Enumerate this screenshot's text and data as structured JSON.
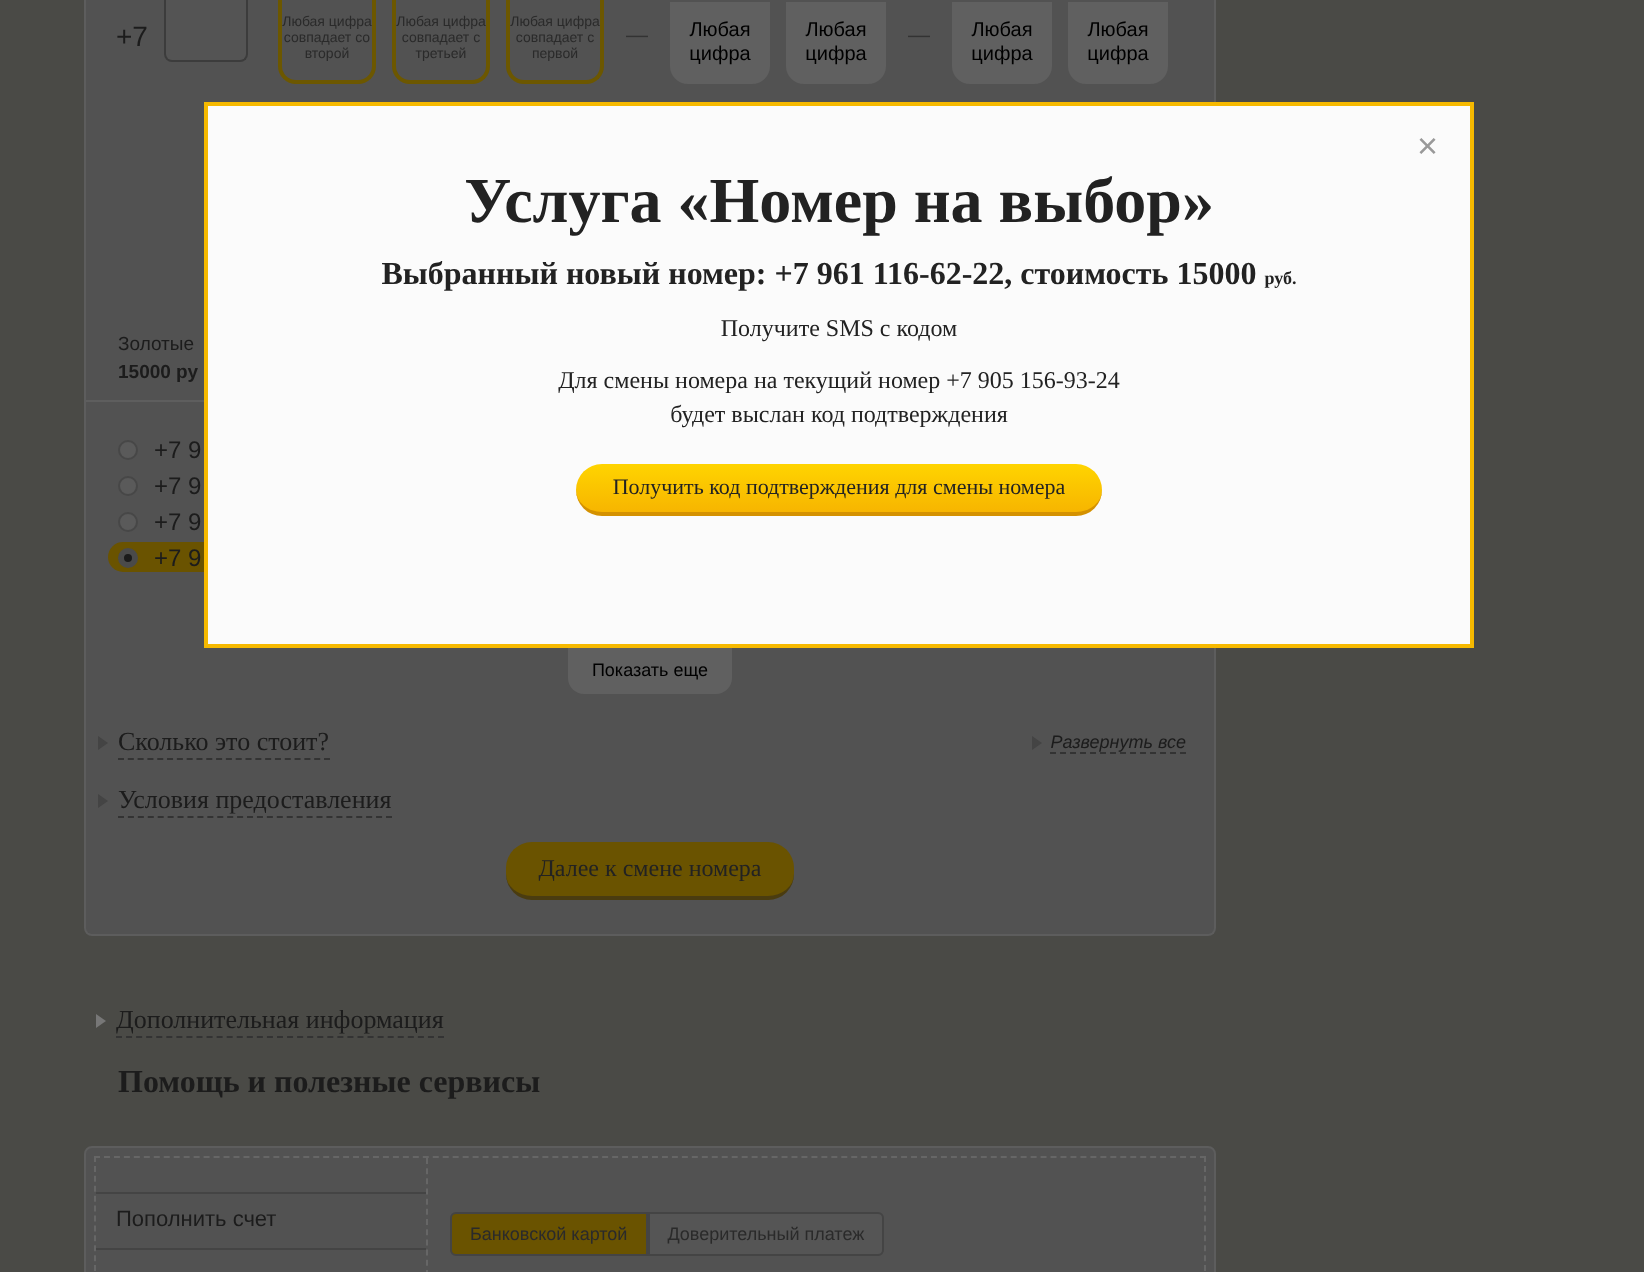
{
  "number_picker": {
    "prefix": "+7",
    "cells": [
      {
        "kind": "linked",
        "text": "Любая цифра совпадает со второй"
      },
      {
        "kind": "linked",
        "text": "Любая цифра совпадает с третьей"
      },
      {
        "kind": "linked",
        "text": "Любая цифра совпадает с первой"
      },
      {
        "kind": "dash",
        "text": "—"
      },
      {
        "kind": "any",
        "text": "Любая цифра"
      },
      {
        "kind": "any",
        "text": "Любая цифра"
      },
      {
        "kind": "dash",
        "text": "—"
      },
      {
        "kind": "any",
        "text": "Любая цифра"
      },
      {
        "kind": "any",
        "text": "Любая цифра"
      }
    ]
  },
  "golden": {
    "lines": [
      "Золотые",
      "15000 ру"
    ]
  },
  "numbers": [
    {
      "text": "+7 9",
      "selected": false
    },
    {
      "text": "+7 9",
      "selected": false
    },
    {
      "text": "+7 9",
      "selected": false
    },
    {
      "text": "+7 9",
      "selected": true
    }
  ],
  "show_more": "Показать еще",
  "sections": [
    "Сколько это стоит?",
    "Условия предоставления"
  ],
  "expand_all": "Развернуть все",
  "next_button": "Далее к смене номера",
  "additional_info": "Дополнительная информация",
  "help_heading": "Помощь и полезные сервисы",
  "help_menu": [
    "Пополнить счет"
  ],
  "payment_tabs": [
    {
      "label": "Банковской картой",
      "selected": true
    },
    {
      "label": "Доверительный платеж",
      "selected": false
    }
  ],
  "modal": {
    "title": "Услуга «Номер на выбор»",
    "selected_number": "Выбранный новый номер: +7 961 116-62-22, стоимость 15000",
    "currency": "руб.",
    "sms_heading": "Получите SMS с кодом",
    "message_lines": [
      "Для смены номера на текущий номер +7 905 156-93-24",
      "будет выслан код подтверждения"
    ],
    "button": "Получить код подтверждения для смены номера",
    "close": "×"
  }
}
